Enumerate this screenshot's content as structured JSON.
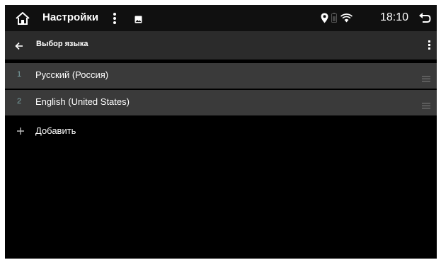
{
  "status_bar": {
    "app_title": "Настройки",
    "time": "18:10",
    "icons": [
      "home-icon",
      "more-vert-icon",
      "image-icon",
      "location-icon",
      "battery-icon",
      "wifi-icon",
      "back-icon"
    ]
  },
  "toolbar": {
    "title": "Выбор языка",
    "icons": [
      "arrow-back-icon",
      "more-vert-icon"
    ]
  },
  "languages": [
    {
      "index": "1",
      "label": "Русский (Россия)"
    },
    {
      "index": "2",
      "label": "English (United States)"
    }
  ],
  "add": {
    "label": "Добавить",
    "icon": "plus-icon"
  },
  "colors": {
    "status_bar_bg": "#101010",
    "toolbar_bg": "#2b2b2b",
    "row_bg": "#3a3a3a",
    "index_color": "#7ea6a8",
    "screen_bg": "#000000"
  }
}
